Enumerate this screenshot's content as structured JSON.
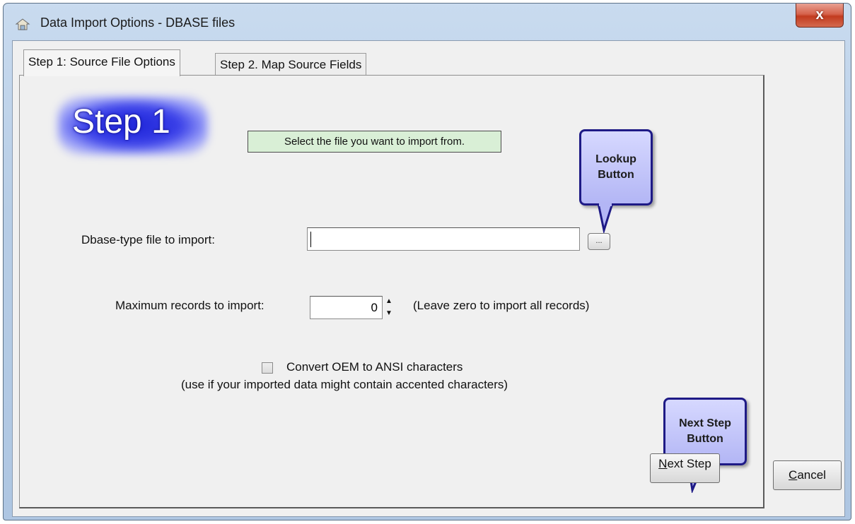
{
  "window": {
    "title": "Data Import Options - DBASE files",
    "close_glyph": "x"
  },
  "tabs": [
    {
      "label": "Step 1: Source File Options",
      "active": true
    },
    {
      "label": "Step 2. Map Source Fields",
      "active": false
    }
  ],
  "step_badge": "Step 1",
  "hint": "Select the file you want to import from.",
  "callouts": {
    "lookup": "Lookup Button",
    "next_step": "Next Step Button"
  },
  "file_field": {
    "label": "Dbase-type file to import:",
    "value": "",
    "lookup_button": "..."
  },
  "max_records": {
    "label": "Maximum records to import:",
    "value": "0",
    "note": "(Leave zero to import all records)"
  },
  "convert_option": {
    "label": "Convert OEM to ANSI characters",
    "note": "(use if your imported data might contain accented characters)",
    "checked": false
  },
  "buttons": {
    "next_step": "Next Step",
    "next_step_underline": "N",
    "next_step_rest": "ext Step",
    "cancel": "Cancel",
    "cancel_underline": "C",
    "cancel_rest": "ancel"
  },
  "colors": {
    "hint_bg": "#d9efd6",
    "callout_border": "#1e1a86",
    "badge_glow": "#1d24d8",
    "close_red": "#c23b1f"
  },
  "icons": {
    "app": "import-icon",
    "spin_up": "▲",
    "spin_down": "▼"
  }
}
